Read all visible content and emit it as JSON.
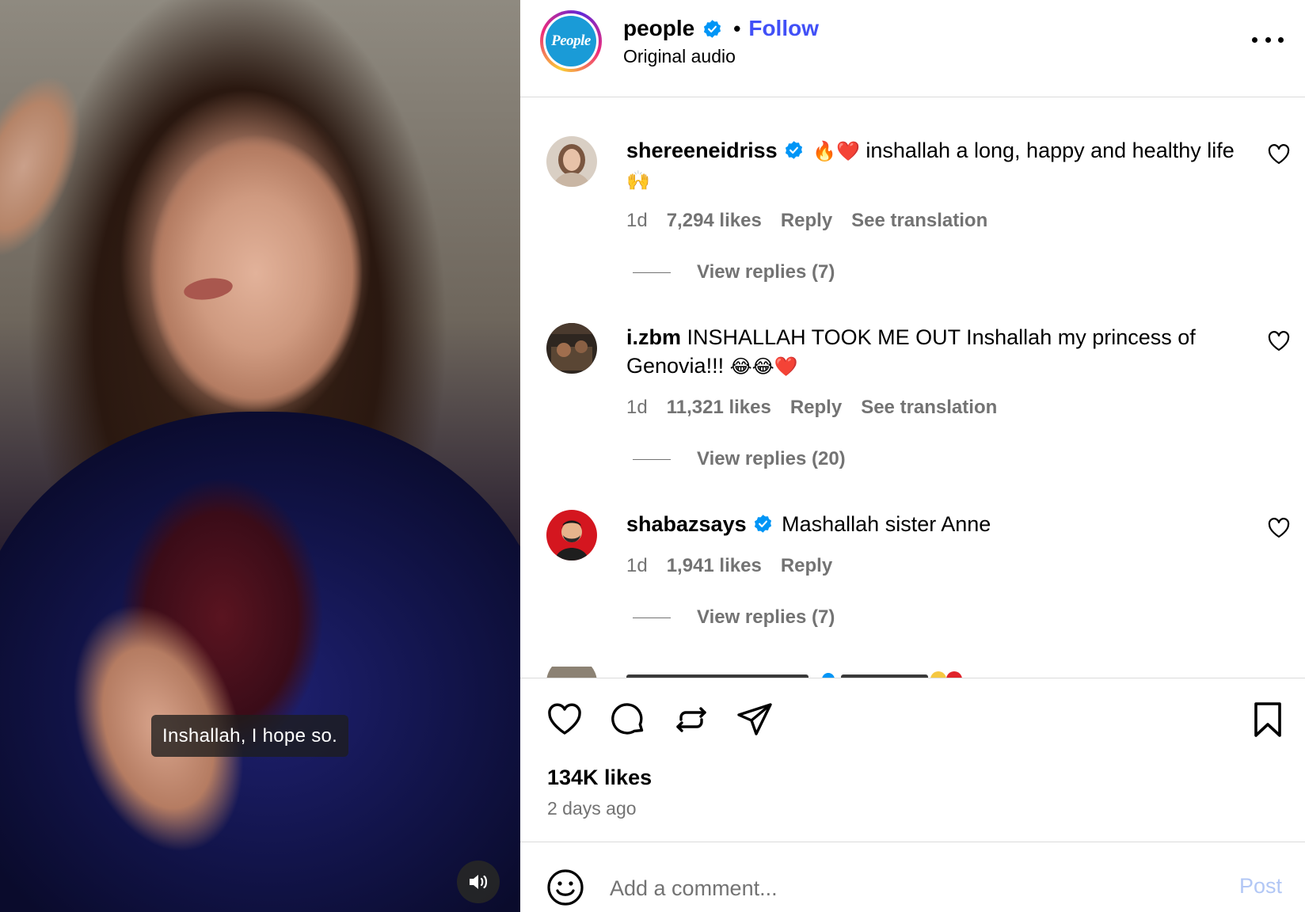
{
  "video": {
    "subtitle": "Inshallah, I hope so.",
    "sound_icon": "speaker-on-icon"
  },
  "header": {
    "username": "people",
    "avatar_text": "People",
    "separator": "•",
    "follow_label": "Follow",
    "audio_label": "Original audio",
    "more_icon": "more-options-icon",
    "colors": {
      "follow": "#4150f7",
      "avatar_bg": "#1a9bd7",
      "verified": "#0095f6"
    }
  },
  "comments": [
    {
      "username": "shereeneidriss",
      "verified": true,
      "emoji_prefix": "🔥❤️",
      "text": "inshallah a long, happy and healthy life",
      "emoji_suffix": "🙌",
      "time": "1d",
      "likes": "7,294 likes",
      "reply_label": "Reply",
      "translation_label": "See translation",
      "view_replies": "View replies (7)"
    },
    {
      "username": "i.zbm",
      "verified": false,
      "text": "INSHALLAH TOOK ME OUT Inshallah my princess of Genovia!!!",
      "emoji_suffix": "😂😂❤️",
      "time": "1d",
      "likes": "11,321 likes",
      "reply_label": "Reply",
      "translation_label": "See translation",
      "view_replies": "View replies (20)"
    },
    {
      "username": "shabazsays",
      "verified": true,
      "text": "Mashallah sister Anne",
      "time": "1d",
      "likes": "1,941 likes",
      "reply_label": "Reply",
      "view_replies": "View replies (7)"
    }
  ],
  "actions": {
    "icons": [
      "heart-icon",
      "comment-icon",
      "repost-icon",
      "share-icon",
      "bookmark-icon"
    ],
    "likes": "134K likes",
    "posted": "2 days ago"
  },
  "add_comment": {
    "placeholder": "Add a comment...",
    "post_label": "Post",
    "emoji_icon": "emoji-smiley-icon",
    "colors": {
      "post": "#b2c7f5"
    }
  }
}
